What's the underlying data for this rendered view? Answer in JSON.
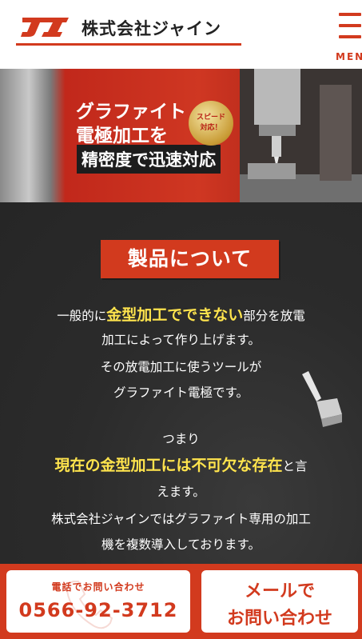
{
  "header": {
    "logo_text": "JI",
    "company_name": "株式会社ジャイン",
    "menu_label": "MENU"
  },
  "hero": {
    "line1": "グラファイト",
    "line2": "電極加工を",
    "line3": "精密度で迅速対応",
    "badge": "スピード対応！"
  },
  "section": {
    "title": "製品について",
    "p1_before": "一般的に",
    "p1_highlight": "金型加工でできない",
    "p1_after": "部分を放電",
    "p2": "加工によって作り上げます。",
    "p3": "その放電加工に使うツールが",
    "p4": "グラファイト電極です。",
    "p5": "つまり",
    "p6_highlight": "現在の金型加工には不可欠な存在",
    "p6_after": "と言",
    "p7": "えます。",
    "p8": "株式会社ジャインではグラファイト専用の加工",
    "p9": "機を複数導入しております。"
  },
  "footer": {
    "phone_label": "電話でお問い合わせ",
    "phone_number": "0566-92-3712",
    "mail_line1": "メールで",
    "mail_line2": "お問い合わせ"
  },
  "colors": {
    "accent": "#d23a1e",
    "highlight": "#ffe44d",
    "background": "#2a2a2a"
  }
}
